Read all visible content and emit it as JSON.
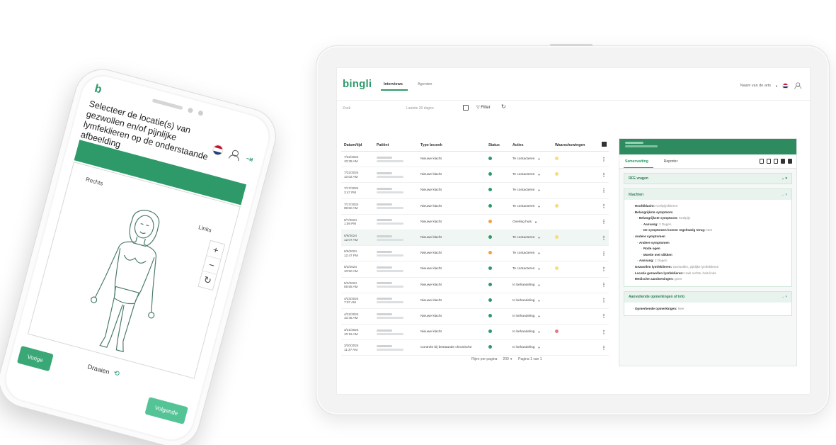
{
  "phone": {
    "logo": "b",
    "title": "Selecteer de locatie(s) van gezwollen en/of pijnlijke lymfeklieren op de onderstaande afbeelding",
    "label_right": "Rechts",
    "label_left": "Links",
    "zoom_in": "+",
    "zoom_out": "−",
    "reset": "↻",
    "rotate_label": "Draaien",
    "prev_button": "Vorige",
    "next_button": "Volgende"
  },
  "app": {
    "brand": "bingli",
    "tabs": [
      {
        "label": "Interviews"
      },
      {
        "label": "Agenten"
      }
    ],
    "user_label": "Naam van de arts",
    "filters": {
      "search_placeholder": "Zoek",
      "date_placeholder": "Laatste 30 dagen",
      "filter_label": "Filter"
    },
    "table": {
      "headers": [
        "Datum/tijd",
        "Patiënt",
        "Type bezoek",
        "Status",
        "Acties",
        "Waarschuwingen"
      ],
      "rows": [
        {
          "date": "7/22/2024",
          "time": "10:38 AM",
          "type": "Nieuwe klacht",
          "status": "green",
          "action": "Te contacteren",
          "warning": "yellow"
        },
        {
          "date": "7/22/2024",
          "time": "10:02 AM",
          "type": "Nieuwe klacht",
          "status": "green",
          "action": "Te contacteren",
          "warning": "yellow"
        },
        {
          "date": "7/17/2024",
          "time": "3:47 PM",
          "type": "Nieuwe klacht",
          "status": "green",
          "action": "Te contacteren",
          "warning": "none"
        },
        {
          "date": "7/17/2024",
          "time": "08:50 AM",
          "type": "Nieuwe klacht",
          "status": "green",
          "action": "Te contacteren",
          "warning": "yellow"
        },
        {
          "date": "6/7/2024",
          "time": "1:59 PM",
          "type": "Nieuwe klacht",
          "status": "orange",
          "action": "Overleg huis",
          "warning": "none"
        },
        {
          "date": "6/6/2024",
          "time": "12:07 AM",
          "type": "Nieuwe klacht",
          "status": "green",
          "action": "Te contacteren",
          "warning": "yellow"
        },
        {
          "date": "6/6/2024",
          "time": "12:47 PM",
          "type": "Nieuwe klacht",
          "status": "orange",
          "action": "Te contacteren",
          "warning": "none"
        },
        {
          "date": "5/2/2024",
          "time": "10:50 AM",
          "type": "Nieuwe klacht",
          "status": "green",
          "action": "Te contacteren",
          "warning": "yellow"
        },
        {
          "date": "5/2/2024",
          "time": "08:58 AM",
          "type": "Nieuwe klacht",
          "status": "green",
          "action": "In behandeling",
          "warning": "none"
        },
        {
          "date": "4/23/2024",
          "time": "7:07 AM",
          "type": "Nieuwe klacht",
          "status": "green",
          "action": "In behandeling",
          "warning": "none"
        },
        {
          "date": "4/22/2024",
          "time": "10:45 AM",
          "type": "Nieuwe klacht",
          "status": "green",
          "action": "In behandeling",
          "warning": "none"
        },
        {
          "date": "3/21/2024",
          "time": "10:15 AM",
          "type": "Nieuwe klacht",
          "status": "green",
          "action": "In behandeling",
          "warning": "red"
        },
        {
          "date": "3/20/2024",
          "time": "11:37 AM",
          "type": "Controle bij bestaande chronische",
          "status": "green",
          "action": "In behandeling",
          "warning": "none"
        }
      ]
    },
    "pagination": {
      "rows_label": "Rijen per pagina",
      "rows_value": "200",
      "page_label": "Pagina 1 van 1"
    },
    "panel": {
      "tabs": [
        "Samenvatting",
        "Reporter"
      ],
      "sections": {
        "rfe": "RFE vragen",
        "klachten": "Klachten",
        "extra": "Aanvullende opmerkingen of info"
      },
      "klachten_lines": [
        {
          "level": "l1",
          "label": "Hoofdklacht:",
          "value": "Keelpijn/klieren"
        },
        {
          "level": "l1",
          "label": "Belangrijkste symptoom",
          "value": ""
        },
        {
          "level": "l2",
          "label": "Belangrijkste symptoom:",
          "value": "Keelpijn"
        },
        {
          "level": "l3",
          "label": "Aanvang:",
          "value": "2 Dagen"
        },
        {
          "level": "l3",
          "label": "De symptomen komen regelmatig terug:",
          "value": "Nee"
        },
        {
          "level": "l1",
          "label": "Andere symptomen",
          "value": ""
        },
        {
          "level": "l2",
          "label": "Andere symptomen",
          "value": ""
        },
        {
          "level": "l3",
          "label": "Rode ogen",
          "value": ""
        },
        {
          "level": "l3",
          "label": "Moeite met slikken",
          "value": ""
        },
        {
          "level": "l2",
          "label": "Aanvang:",
          "value": "2 Dagen"
        },
        {
          "level": "l1",
          "label": "Gezwollen lymfeklieren:",
          "value": "Gezwollen, pijnlijke lymfeklieren"
        },
        {
          "level": "l1",
          "label": "Locatie gezwollen lymfeklieren:",
          "value": "Hals rechts, hals links"
        },
        {
          "level": "l1",
          "label": "Medische aandoeningen:",
          "value": "geen"
        }
      ],
      "extra_line": {
        "label": "Opmerkende opmerkingen:",
        "value": "Nee"
      }
    }
  }
}
